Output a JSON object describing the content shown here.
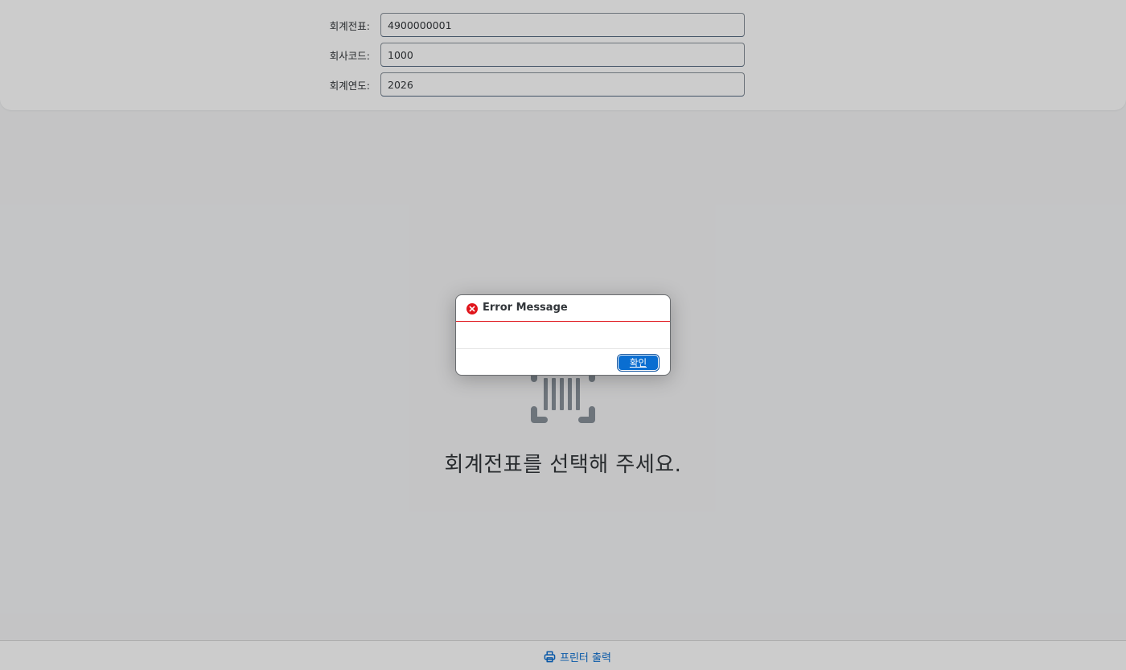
{
  "form": {
    "rows": [
      {
        "label": "회계전표:",
        "value": "4900000001"
      },
      {
        "label": "회사코드:",
        "value": "1000"
      },
      {
        "label": "회계연도:",
        "value": "2026"
      }
    ]
  },
  "main": {
    "empty_icon": "barcode-scan-icon",
    "empty_text": "회계전표를 선택해 주세요."
  },
  "footer": {
    "print_icon": "printer-icon",
    "print_label": "프린터 출력"
  },
  "dialog": {
    "icon": "error-icon",
    "title": "Error Message",
    "message": "",
    "confirm_label": "확인"
  },
  "colors": {
    "accent": "#0a6ed1",
    "error": "#e0151c",
    "text": "#32363a",
    "icon_gray": "#89919a"
  }
}
